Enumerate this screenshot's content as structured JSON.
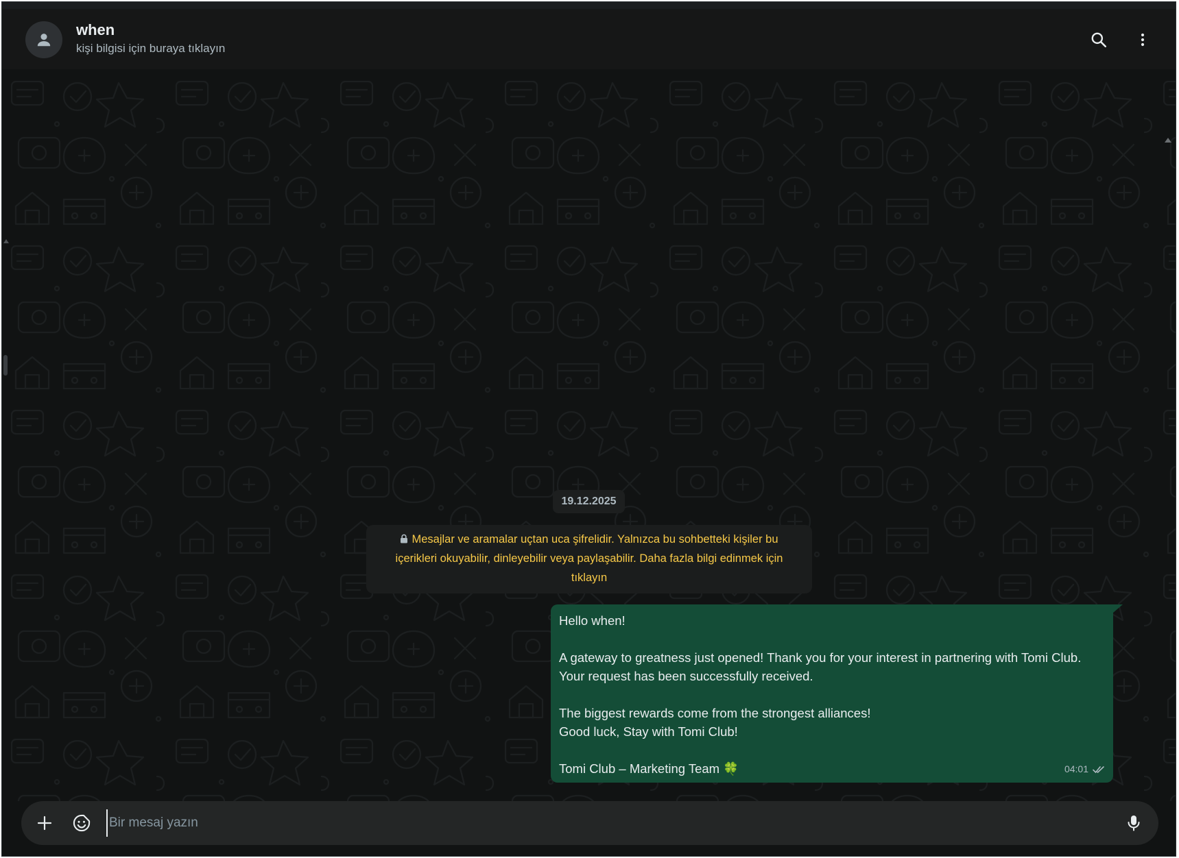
{
  "header": {
    "contact_name": "when",
    "contact_subtitle": "kişi bilgisi için buraya tıklayın",
    "avatar_icon": "person-icon",
    "search_icon": "search-icon",
    "menu_icon": "more-vertical-icon"
  },
  "chat": {
    "date_chip": "19.12.2025",
    "encryption_notice": "Mesajlar ve aramalar uçtan uca şifrelidir. Yalnızca bu sohbetteki kişiler bu içerikleri okuyabilir, dinleyebilir veya paylaşabilir. Daha fazla bilgi edinmek için tıklayın",
    "messages": [
      {
        "direction": "outgoing",
        "lines": [
          "Hello when!",
          "",
          "A gateway to greatness just opened! Thank you for your interest in partnering with Tomi Club.",
          "Your request has been successfully received.",
          "",
          "The biggest rewards come from the strongest alliances!",
          "Good luck, Stay with Tomi Club!",
          "",
          "Tomi Club – Marketing Team 🍀"
        ],
        "time": "04:01",
        "status_icon": "double-check-icon"
      }
    ]
  },
  "composer": {
    "placeholder": "Bir mesaj yazın",
    "value": "",
    "attach_icon": "plus-icon",
    "sticker_icon": "sticker-icon",
    "mic_icon": "microphone-icon"
  },
  "colors": {
    "header_bg": "#161717",
    "chat_bg": "#111313",
    "outgoing_bubble": "#144d37",
    "notice_text": "#f7c948",
    "primary_text": "#e9edef",
    "secondary_text": "#aebac1"
  }
}
